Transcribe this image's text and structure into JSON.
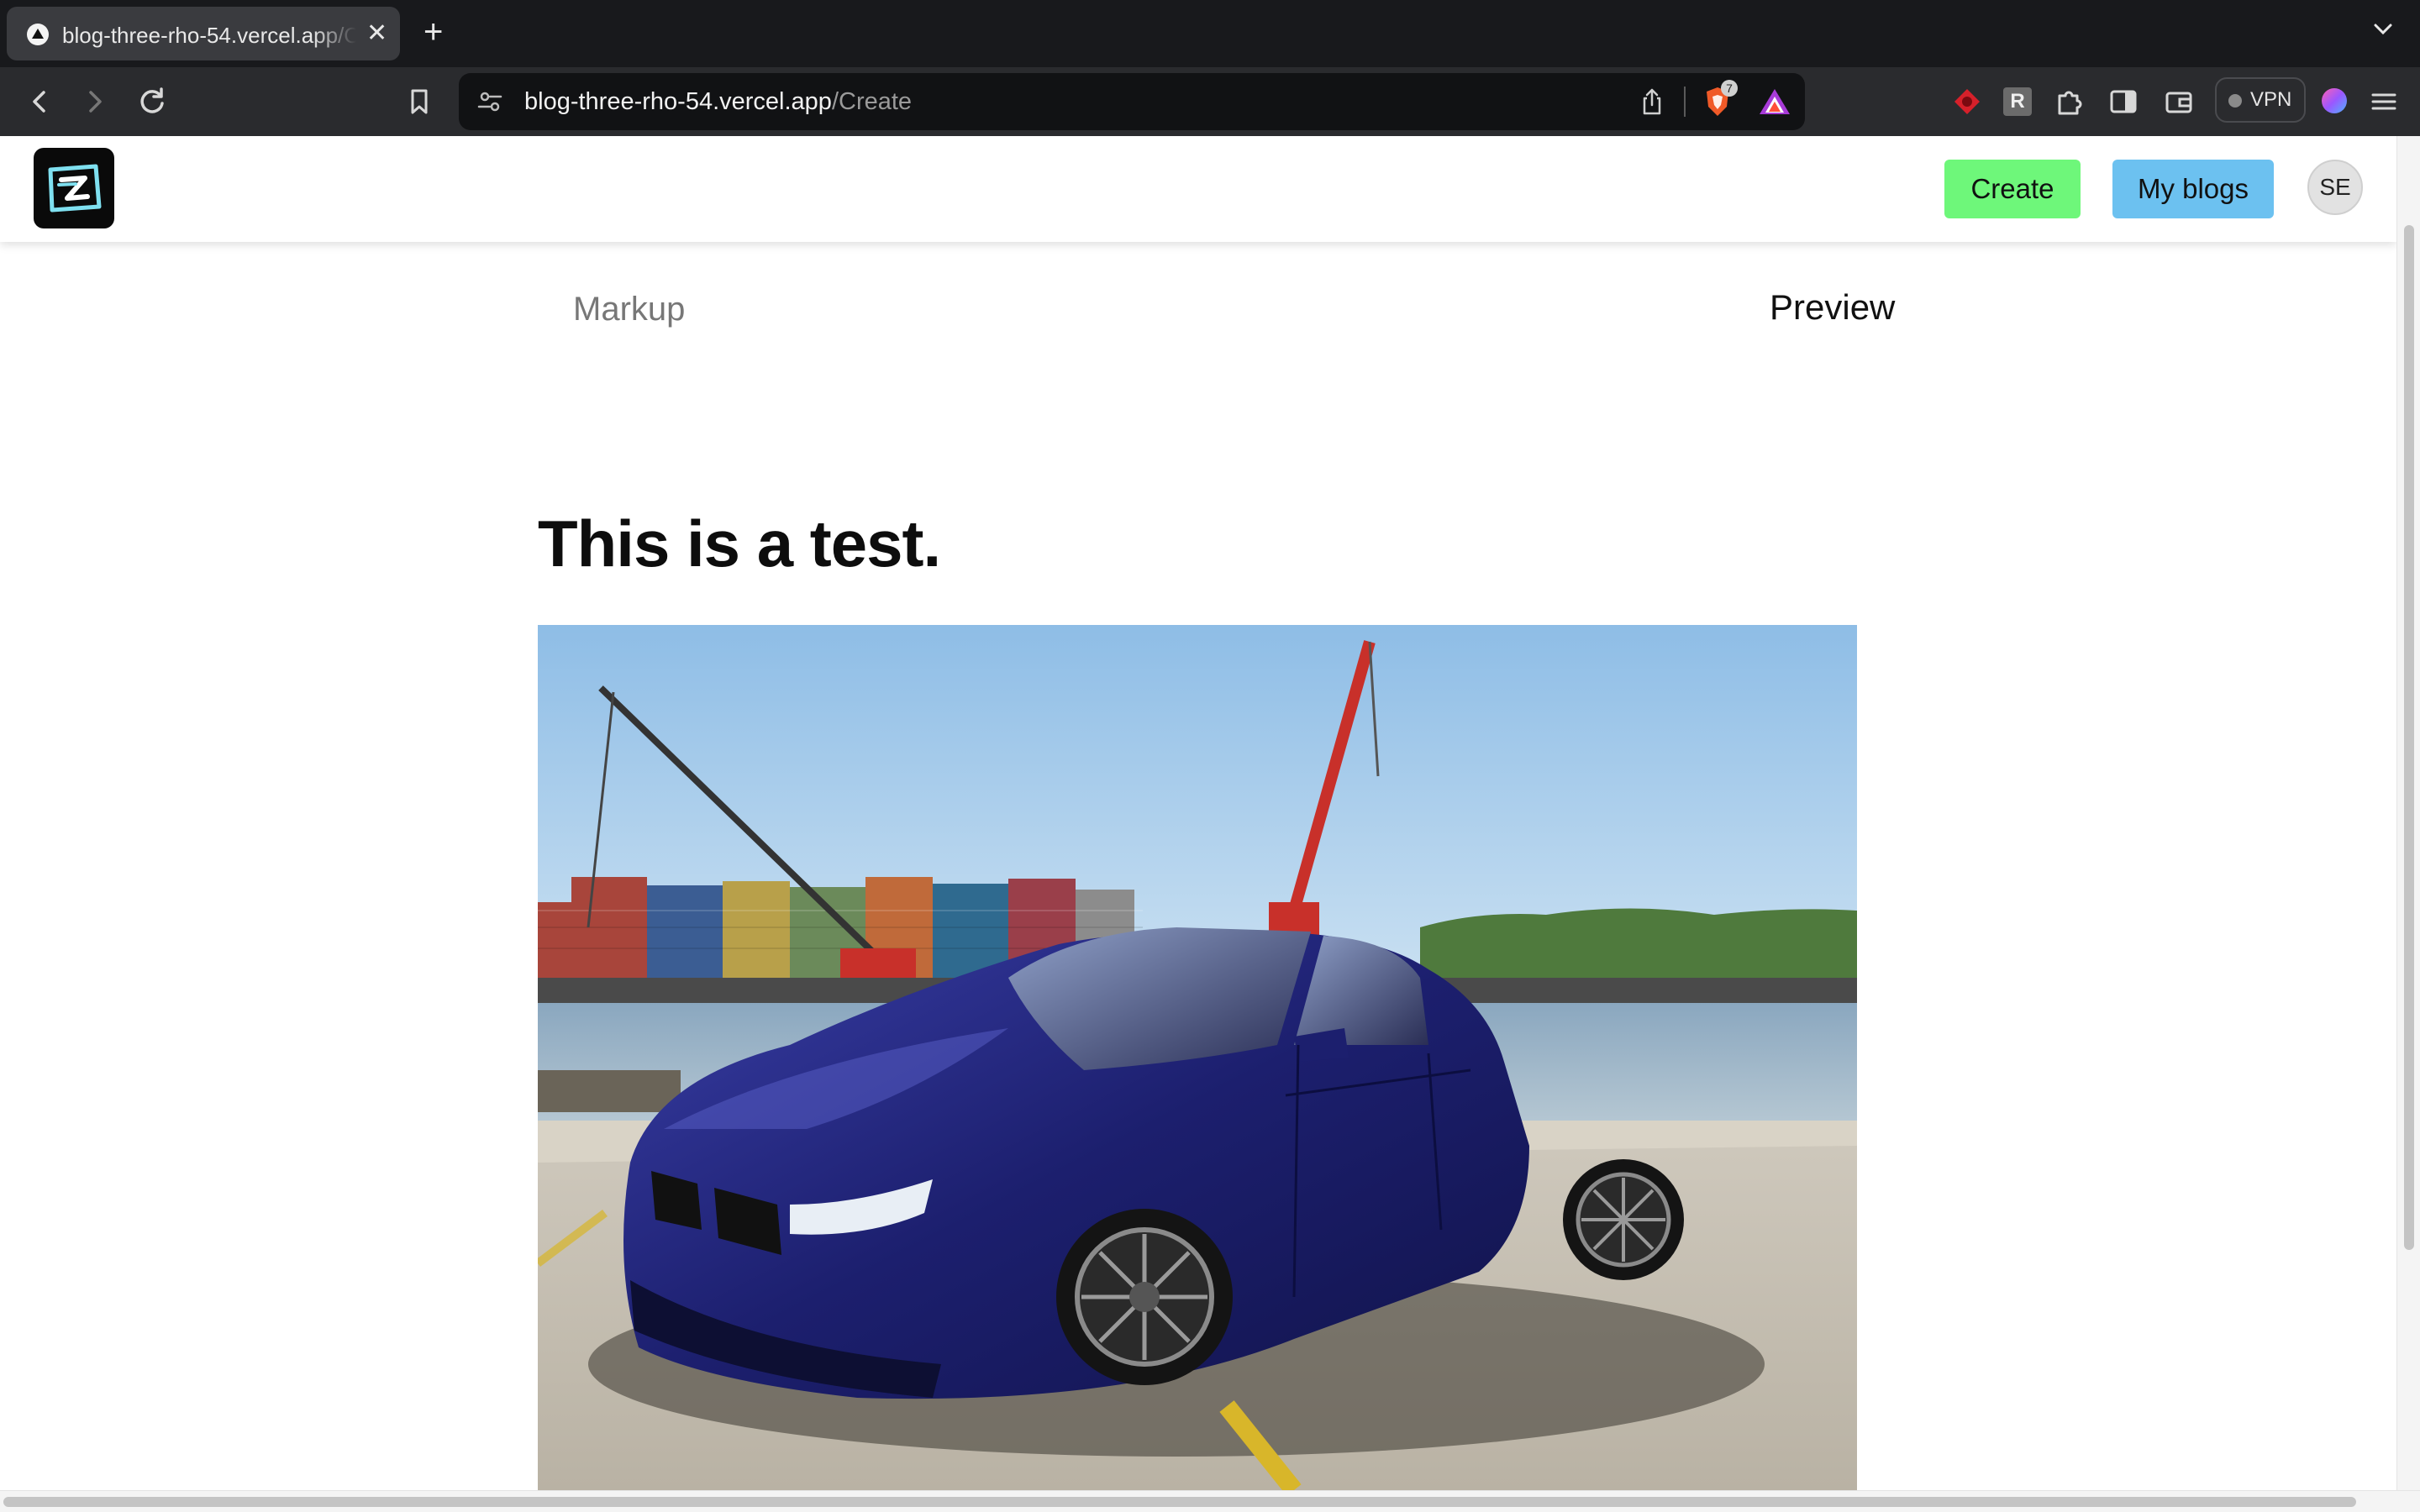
{
  "browser": {
    "tab_title": "blog-three-rho-54.vercel.app/Create",
    "tab_close_glyph": "✕",
    "new_tab_glyph": "+",
    "tab_list_glyph": "⌄",
    "url_host": "blog-three-rho-54.vercel.app",
    "url_path": "/Create",
    "shield_count": "7",
    "vpn_label": "VPN",
    "nav": {
      "back_icon": "chevron-left-icon",
      "forward_icon": "chevron-right-icon",
      "reload_icon": "reload-icon",
      "bookmark_icon": "bookmark-icon"
    },
    "extensions": [
      "red-diamond-extension-icon",
      "r-extension-icon",
      "puzzle-extensions-icon",
      "sidebar-toggle-icon",
      "wallet-icon",
      "vpn-icon",
      "profile-gradient-icon",
      "menu-icon"
    ],
    "ext_r_label": "R"
  },
  "site": {
    "logo_alt": "EZ",
    "nav_create": "Create",
    "nav_myblogs": "My blogs",
    "avatar_initials": "SE",
    "colors": {
      "create_button": "#6ef77a",
      "myblogs_button": "#6cc1f0"
    }
  },
  "editor": {
    "tab_markup": "Markup",
    "tab_preview": "Preview",
    "active_tab": "Preview"
  },
  "preview": {
    "title": "This is a test.",
    "image_description_icon": "car-photo-image"
  }
}
